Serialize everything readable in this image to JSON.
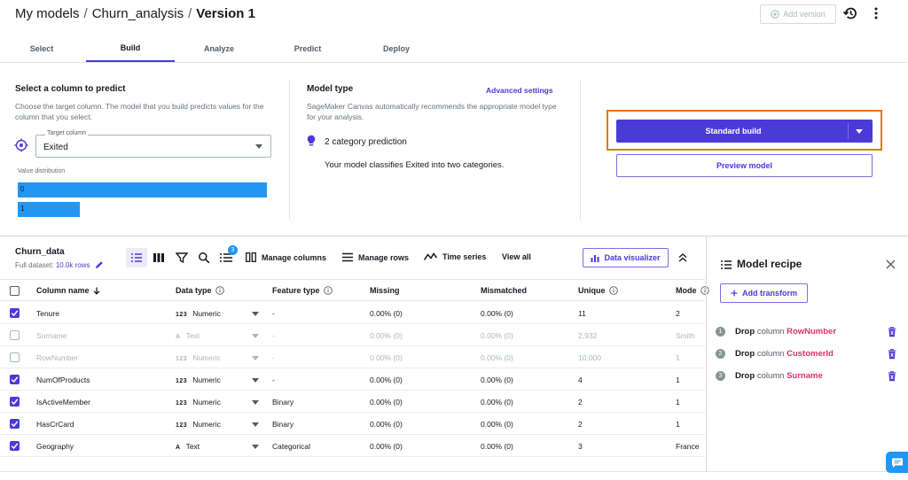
{
  "header": {
    "breadcrumb": [
      "My models",
      "Churn_analysis"
    ],
    "separator": "/",
    "current": "Version 1",
    "add_version_label": "Add version"
  },
  "tabs": [
    {
      "label": "Select"
    },
    {
      "label": "Build"
    },
    {
      "label": "Analyze"
    },
    {
      "label": "Predict"
    },
    {
      "label": "Deploy"
    }
  ],
  "target": {
    "title": "Select a column to predict",
    "description": "Choose the target column. The model that you build predicts values for the column that you select.",
    "field_label": "Target column",
    "value": "Exited",
    "distribution_label": "Value distribution",
    "distribution": [
      {
        "label": "0",
        "fraction": 1.0
      },
      {
        "label": "1",
        "fraction": 0.25
      }
    ]
  },
  "model_type": {
    "title": "Model type",
    "advanced_link": "Advanced settings",
    "description": "SageMaker Canvas automatically recommends the appropriate model type for your analysis.",
    "prediction": "2 category prediction",
    "detail": "Your model classifies Exited into two categories."
  },
  "build": {
    "standard_label": "Standard build",
    "preview_label": "Preview model"
  },
  "dataset": {
    "name": "Churn_data",
    "full_label": "Full dataset:",
    "rows_label": "10.0k rows",
    "badge": "3",
    "manage_columns": "Manage columns",
    "manage_rows": "Manage rows",
    "time_series": "Time series",
    "view_all": "View all",
    "data_visualizer": "Data visualizer"
  },
  "table": {
    "headers": {
      "column_name": "Column name",
      "data_type": "Data type",
      "feature_type": "Feature type",
      "missing": "Missing",
      "mismatched": "Mismatched",
      "unique": "Unique",
      "mode": "Mode"
    },
    "rows": [
      {
        "checked": true,
        "name": "Tenure",
        "dtype_icon": "123",
        "dtype": "Numeric",
        "feature": "-",
        "missing": "0.00% (0)",
        "mismatched": "0.00% (0)",
        "unique": "11",
        "mode": "2"
      },
      {
        "checked": false,
        "name": "Surname",
        "dtype_icon": "A",
        "dtype": "Text",
        "feature": "-",
        "missing": "0.00% (0)",
        "mismatched": "0.00% (0)",
        "unique": "2,932",
        "mode": "Smith"
      },
      {
        "checked": false,
        "name": "RowNumber",
        "dtype_icon": "123",
        "dtype": "Numeric",
        "feature": "-",
        "missing": "0.00% (0)",
        "mismatched": "0.00% (0)",
        "unique": "10,000",
        "mode": "1"
      },
      {
        "checked": true,
        "name": "NumOfProducts",
        "dtype_icon": "123",
        "dtype": "Numeric",
        "feature": "-",
        "missing": "0.00% (0)",
        "mismatched": "0.00% (0)",
        "unique": "4",
        "mode": "1"
      },
      {
        "checked": true,
        "name": "IsActiveMember",
        "dtype_icon": "123",
        "dtype": "Numeric",
        "feature": "Binary",
        "missing": "0.00% (0)",
        "mismatched": "0.00% (0)",
        "unique": "2",
        "mode": "1"
      },
      {
        "checked": true,
        "name": "HasCrCard",
        "dtype_icon": "123",
        "dtype": "Numeric",
        "feature": "Binary",
        "missing": "0.00% (0)",
        "mismatched": "0.00% (0)",
        "unique": "2",
        "mode": "1"
      },
      {
        "checked": true,
        "name": "Geography",
        "dtype_icon": "A",
        "dtype": "Text",
        "feature": "Categorical",
        "missing": "0.00% (0)",
        "mismatched": "0.00% (0)",
        "unique": "3",
        "mode": "France"
      }
    ]
  },
  "recipe": {
    "title": "Model recipe",
    "add_transform": "Add transform",
    "steps": [
      {
        "num": "1",
        "action": "Drop",
        "word": "column",
        "column": "RowNumber"
      },
      {
        "num": "2",
        "action": "Drop",
        "word": "column",
        "column": "CustomerId"
      },
      {
        "num": "3",
        "action": "Drop",
        "word": "column",
        "column": "Surname"
      }
    ]
  },
  "colors": {
    "accent": "#4a3ad8",
    "highlight": "#ec7211",
    "distribution_bar": "#2196f3",
    "recipe_column": "#d6336c"
  }
}
